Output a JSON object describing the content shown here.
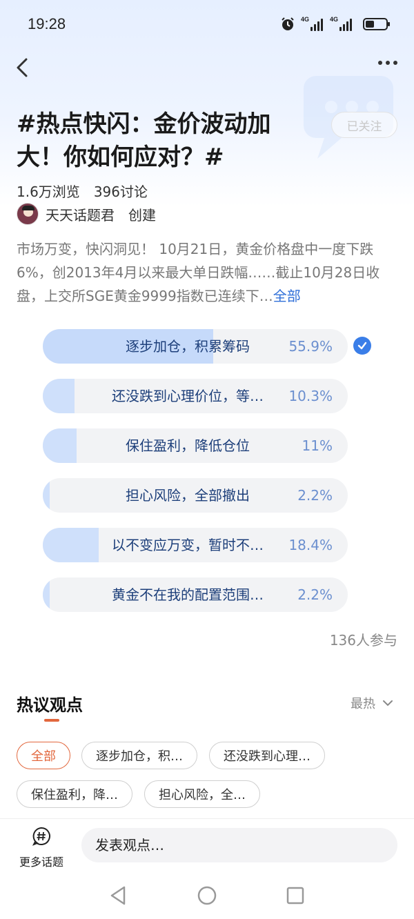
{
  "status_bar": {
    "time": "19:28",
    "signal1_label": "4G",
    "signal2_label": "4G"
  },
  "header": {
    "title": "#热点快闪：金价波动加大！你如何应对？#",
    "follow_label": "已关注",
    "views": "1.6万浏览",
    "discussions": "396讨论",
    "creator_name": "天天话题君",
    "creator_role": "创建"
  },
  "description": {
    "text": "市场万变，快闪洞见！ 10月21日，黄金价格盘中一度下跌6%，创2013年4月以来最大单日跌幅……截止10月28日收盘，上交所SGE黄金9999指数已连续下…",
    "more_label": "全部"
  },
  "poll": {
    "options": [
      {
        "label": "逐步加仓，积累筹码",
        "percent_text": "55.9%",
        "percent": 55.9,
        "selected": true
      },
      {
        "label": "还没跌到心理价位，等…",
        "percent_text": "10.3%",
        "percent": 10.3,
        "selected": false
      },
      {
        "label": "保住盈利，降低仓位",
        "percent_text": "11%",
        "percent": 11,
        "selected": false
      },
      {
        "label": "担心风险，全部撤出",
        "percent_text": "2.2%",
        "percent": 2.2,
        "selected": false
      },
      {
        "label": "以不变应万变，暂时不…",
        "percent_text": "18.4%",
        "percent": 18.4,
        "selected": false
      },
      {
        "label": "黄金不在我的配置范围…",
        "percent_text": "2.2%",
        "percent": 2.2,
        "selected": false
      }
    ],
    "participants": "136人参与"
  },
  "opinions": {
    "title": "热议观点",
    "sort_label": "最热",
    "chips": [
      "全部",
      "逐步加仓，积…",
      "还没跌到心理…",
      "保住盈利，降…",
      "担心风险，全…"
    ]
  },
  "bottom_bar": {
    "more_topics_label": "更多话题",
    "input_placeholder": "发表观点…"
  },
  "colors": {
    "accent": "#e2673d",
    "poll_fill": "#cfe0fb",
    "poll_text": "#1d3f7a",
    "check": "#3a7ee8"
  }
}
